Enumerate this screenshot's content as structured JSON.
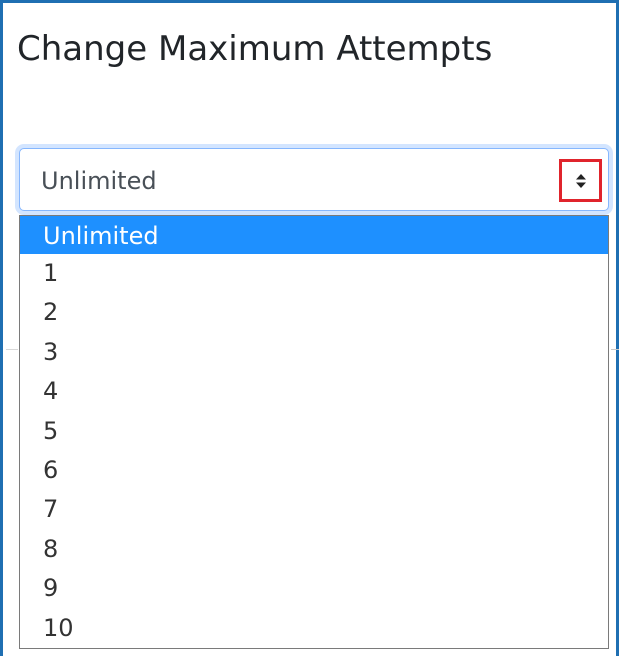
{
  "dialog": {
    "title": "Change Maximum Attempts"
  },
  "select": {
    "value": "Unlimited",
    "arrow_icon": "sort-arrows-icon",
    "highlight_color": "#e0242c",
    "options": [
      {
        "label": "Unlimited",
        "selected": true
      },
      {
        "label": "1",
        "selected": false
      },
      {
        "label": "2",
        "selected": false
      },
      {
        "label": "3",
        "selected": false
      },
      {
        "label": "4",
        "selected": false
      },
      {
        "label": "5",
        "selected": false
      },
      {
        "label": "6",
        "selected": false
      },
      {
        "label": "7",
        "selected": false
      },
      {
        "label": "8",
        "selected": false
      },
      {
        "label": "9",
        "selected": false
      },
      {
        "label": "10",
        "selected": false
      }
    ]
  },
  "colors": {
    "accent": "#1f6fb2",
    "selected_option_bg": "#1e90ff"
  }
}
